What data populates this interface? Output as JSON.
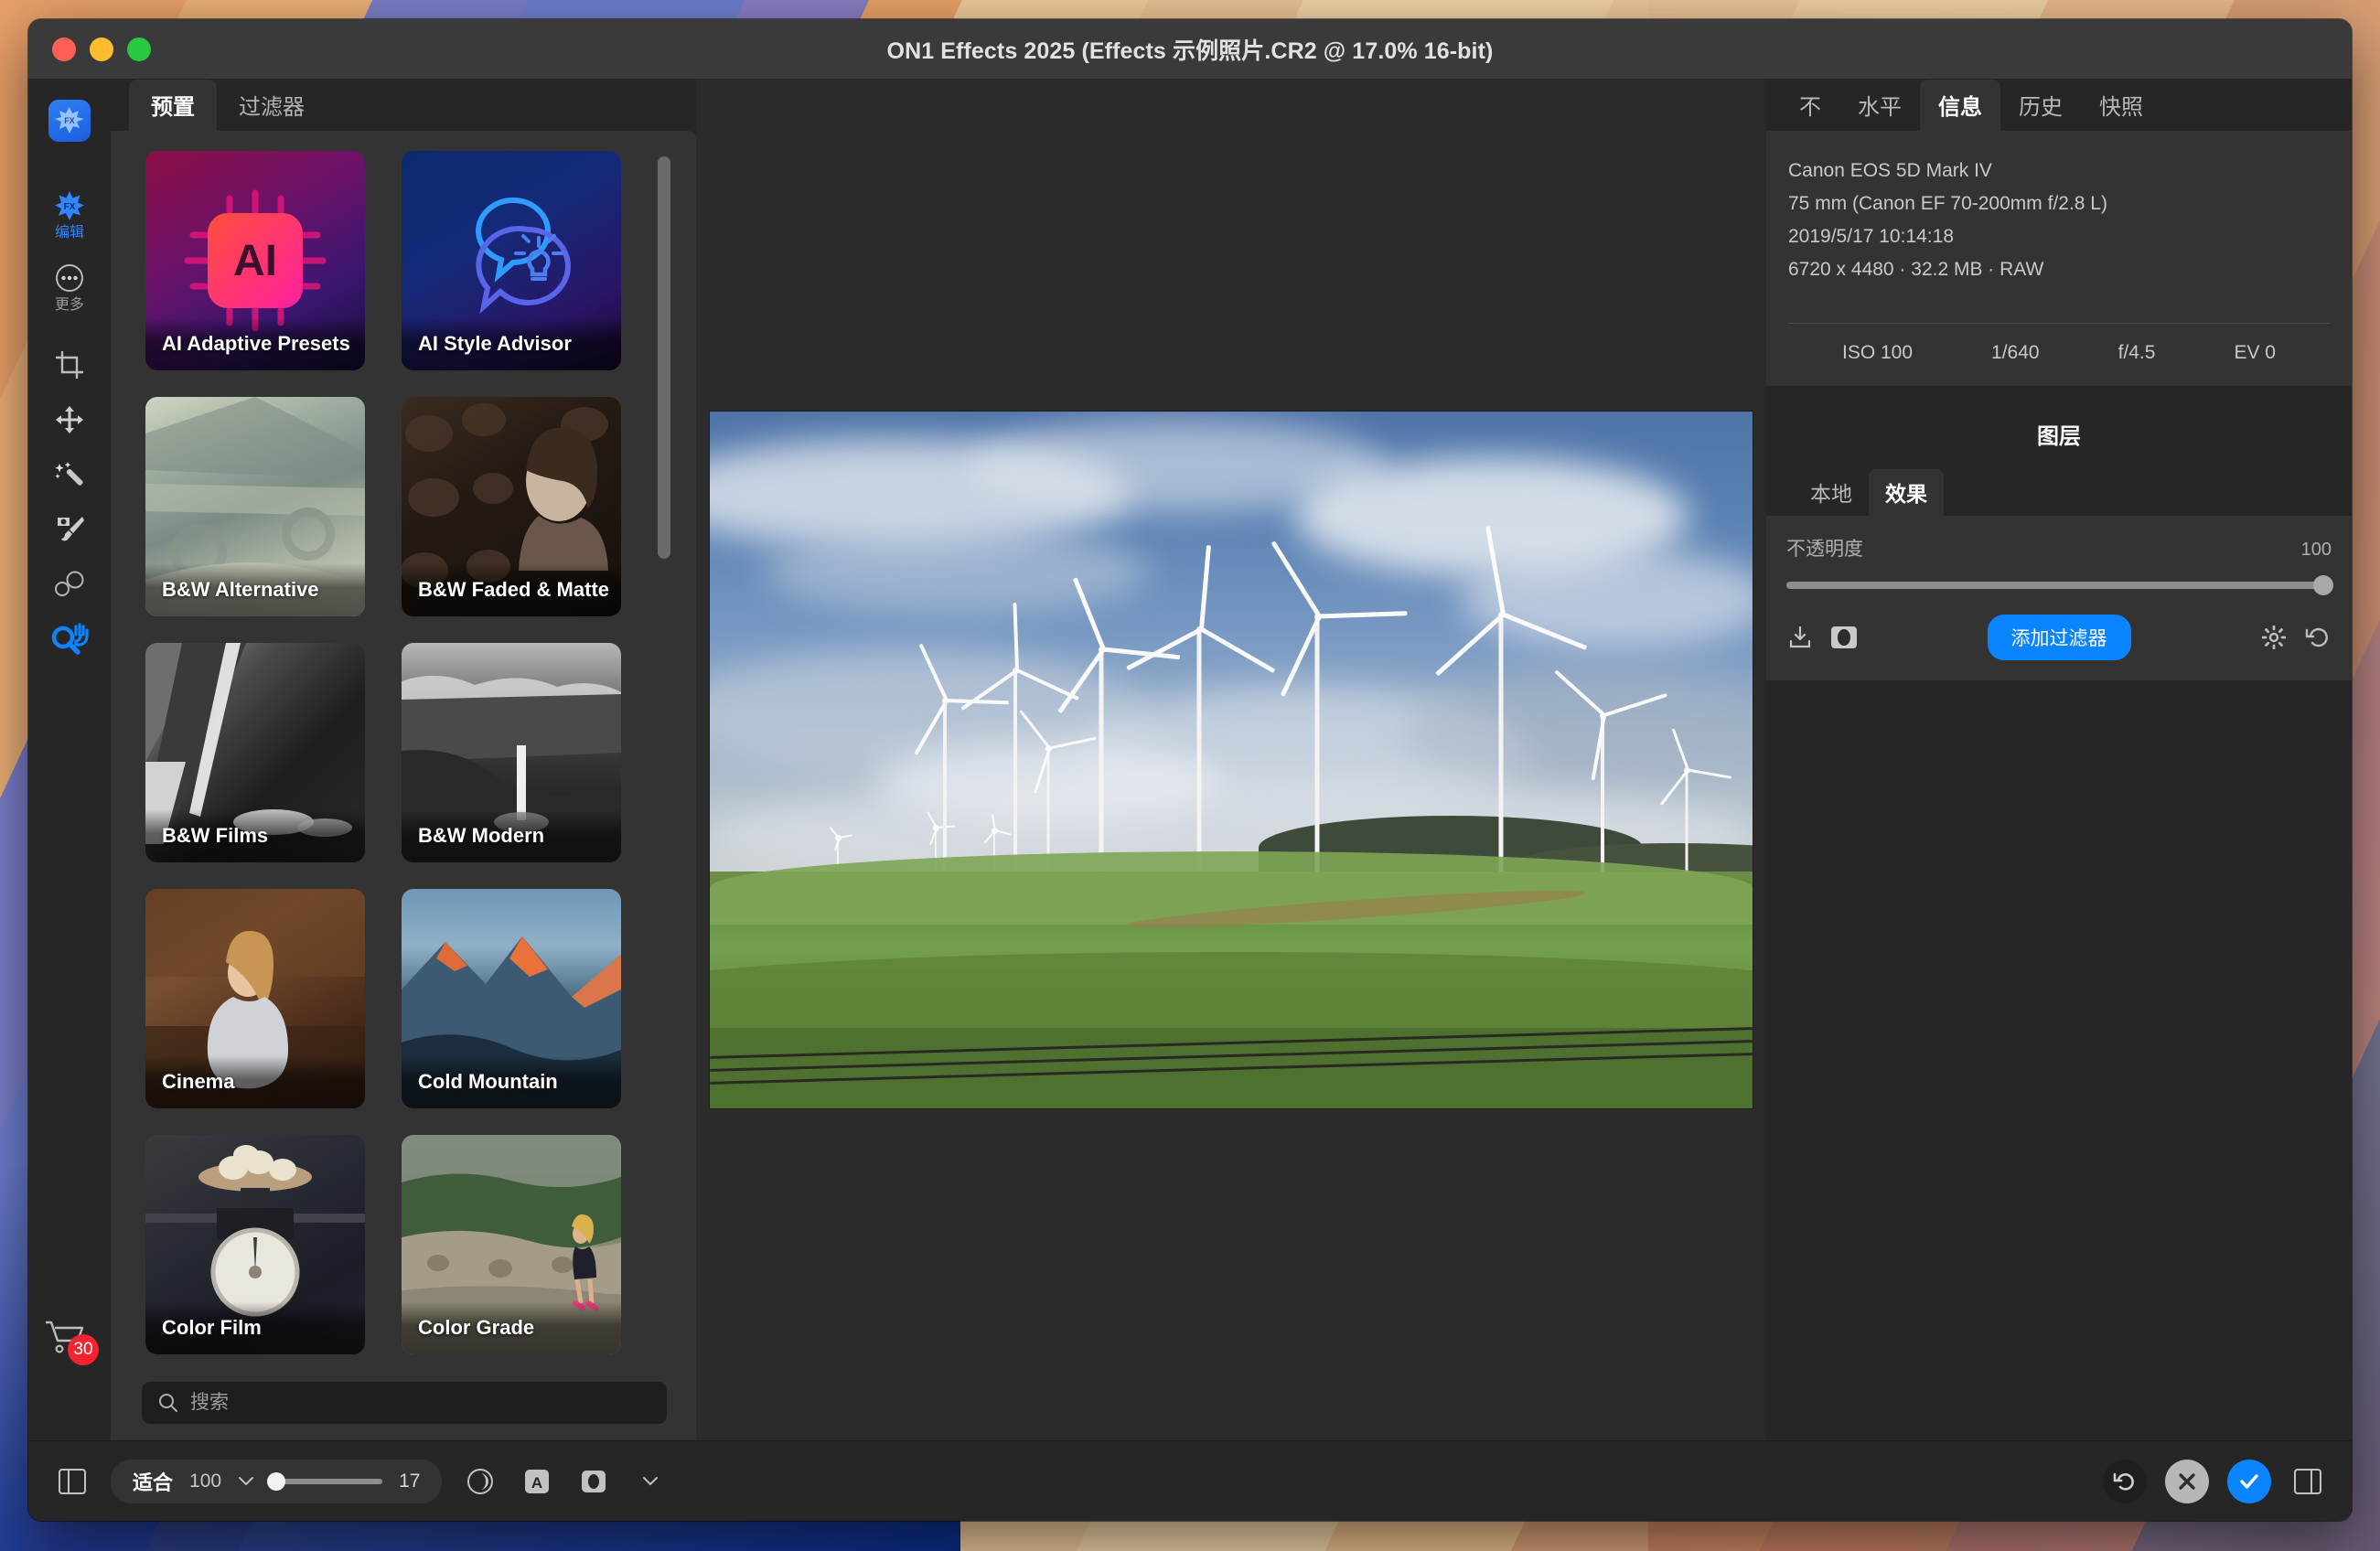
{
  "window": {
    "title": "ON1 Effects 2025 (Effects 示例照片.CR2 @ 17.0% 16-bit)",
    "traffic_lights": [
      "close",
      "minimize",
      "maximize"
    ]
  },
  "rail": {
    "app_icon": "fx-app-icon",
    "items": [
      {
        "icon": "fx-star-icon",
        "label": "编辑",
        "active": true
      },
      {
        "icon": "ellipsis-circle-icon",
        "label": "更多",
        "active": false
      },
      {
        "icon": "crop-icon",
        "label": "",
        "active": false
      },
      {
        "icon": "move-icon",
        "label": "",
        "active": false
      },
      {
        "icon": "magic-wand-icon",
        "label": "",
        "active": false
      },
      {
        "icon": "brush-icon",
        "label": "",
        "active": false
      },
      {
        "icon": "masking-bug-icon",
        "label": "",
        "active": false
      },
      {
        "icon": "zoom-hand-icon",
        "label": "",
        "active": true
      }
    ],
    "cart": {
      "icon": "shopping-cart-icon",
      "badge": "30"
    }
  },
  "presets": {
    "tabs": [
      {
        "label": "预置",
        "active": true
      },
      {
        "label": "过滤器",
        "active": false
      }
    ],
    "cards": [
      {
        "label": "AI Adaptive Presets",
        "thumb": "ai-chip-gradient"
      },
      {
        "label": "AI Style Advisor",
        "thumb": "ai-bubble-gradient"
      },
      {
        "label": "B&W Alternative",
        "thumb": "stone-carving-photo"
      },
      {
        "label": "B&W Faded & Matte",
        "thumb": "woman-ivy-photo"
      },
      {
        "label": "B&W Films",
        "thumb": "bridge-underside-photo"
      },
      {
        "label": "B&W Modern",
        "thumb": "waterfall-canyon-photo"
      },
      {
        "label": "Cinema",
        "thumb": "seated-woman-photo"
      },
      {
        "label": "Cold Mountain",
        "thumb": "snowy-peaks-photo"
      },
      {
        "label": "Color Film",
        "thumb": "kitchen-scale-photo"
      },
      {
        "label": "Color Grade",
        "thumb": "woman-stone-wall-photo"
      }
    ],
    "search": {
      "icon": "search-icon",
      "placeholder": "搜索",
      "value": ""
    }
  },
  "canvas": {
    "image_description": "wind-turbines-green-hills-photo"
  },
  "right_panel": {
    "tabs": [
      {
        "label": "不",
        "active": false
      },
      {
        "label": "水平",
        "active": false
      },
      {
        "label": "信息",
        "active": true
      },
      {
        "label": "历史",
        "active": false
      },
      {
        "label": "快照",
        "active": false
      }
    ],
    "info": {
      "camera": "Canon EOS 5D Mark IV",
      "lens": "75 mm (Canon EF 70-200mm f/2.8 L)",
      "datetime": "2019/5/17  10:14:18",
      "file": "6720 x 4480 · 32.2 MB · RAW",
      "exif": [
        "ISO 100",
        "1/640",
        "f/4.5",
        "EV 0"
      ]
    },
    "layers": {
      "title": "图层",
      "tabs": [
        {
          "label": "本地",
          "active": false
        },
        {
          "label": "效果",
          "active": true
        }
      ],
      "opacity_label": "不透明度",
      "opacity_value": "100",
      "opacity_percent": 100,
      "actions": {
        "import_icon": "import-icon",
        "mask_icon": "mask-icon",
        "add_filter_label": "添加过滤器",
        "settings_icon": "gear-icon",
        "reset_icon": "reset-icon"
      }
    }
  },
  "bottom_bar": {
    "left_panel_toggle_icon": "left-panel-toggle-icon",
    "fit_label": "适合",
    "fit_value": "100",
    "fit_chevron_icon": "chevron-down-icon",
    "zoom_value": "17",
    "zoom_percent": 8,
    "view_icons": [
      "eye-icon",
      "letter-a-icon",
      "mask-circle-icon",
      "chevron-down-icon"
    ],
    "reset_icon": "reset-circle-icon",
    "cancel_icon": "close-icon",
    "confirm_icon": "check-icon",
    "right_panel_toggle_icon": "right-panel-toggle-icon"
  },
  "colors": {
    "accent_blue": "#0a84ff",
    "badge_red": "#f4232f",
    "panel_bg": "#333333",
    "window_bg": "#262626"
  }
}
